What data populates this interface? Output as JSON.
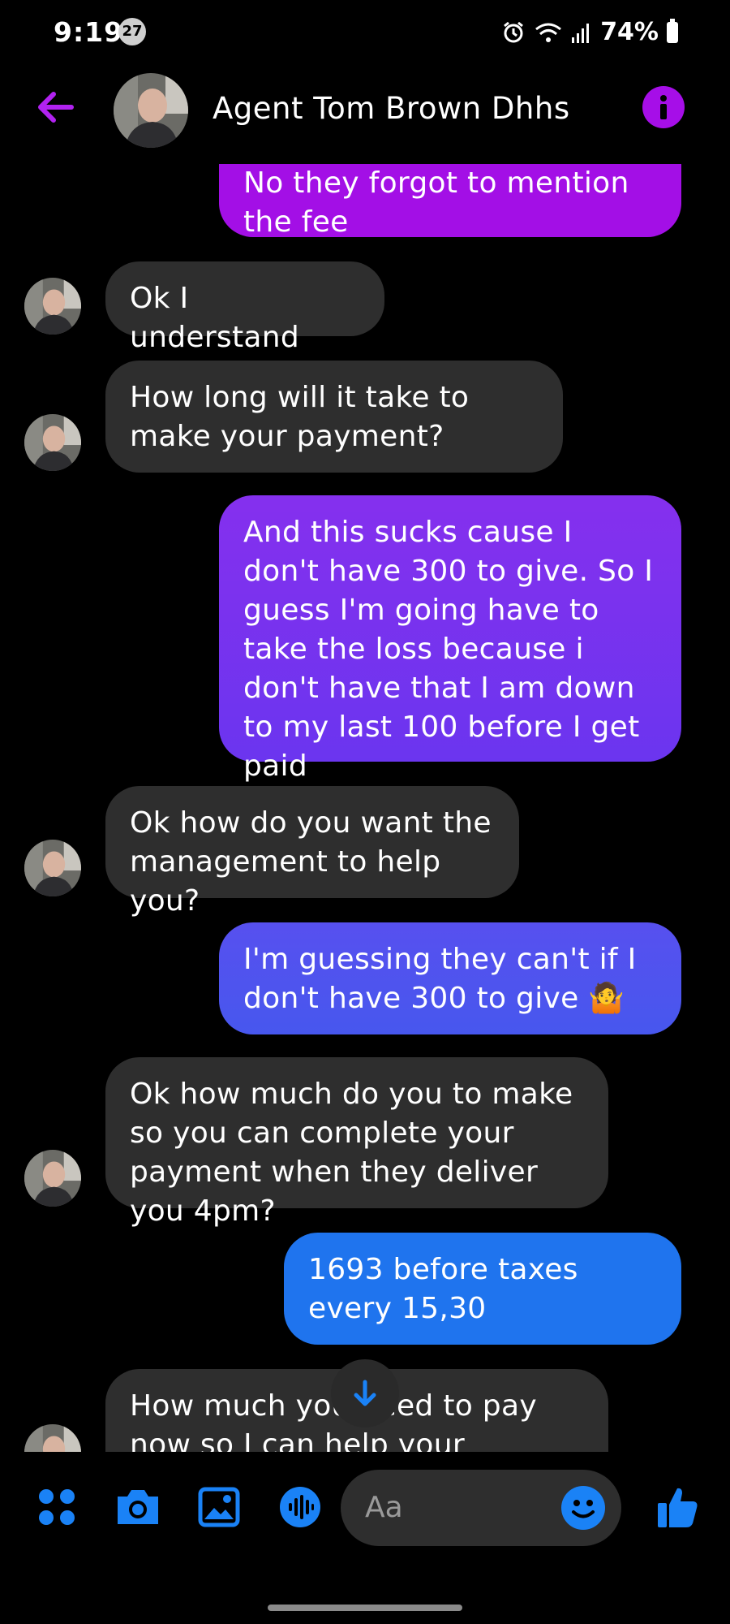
{
  "status_bar": {
    "time": "9:19",
    "notification_count": "27",
    "battery": "74%"
  },
  "header": {
    "contact_name": "Agent Tom Brown Dhhs"
  },
  "messages": [
    {
      "direction": "out",
      "text": "No they forgot to mention the fee",
      "color": "#a30fe6"
    },
    {
      "direction": "in",
      "text": "Ok I understand"
    },
    {
      "direction": "in",
      "text": "How long will it take to make your payment?"
    },
    {
      "direction": "out",
      "text": "And this sucks cause I don't have 300 to give. So I guess I'm going have to take the loss because i don't have that I am down to my last 100 before I get paid",
      "color": "#7b2ff0"
    },
    {
      "direction": "in",
      "text": "Ok how do you want the management to help you?"
    },
    {
      "direction": "out",
      "text": "I'm guessing they can't if I don't have 300 to give 🤷",
      "color": "#4d53ef"
    },
    {
      "direction": "in",
      "text": "Ok how much do you to make so you can complete your payment when they deliver you 4pm?"
    },
    {
      "direction": "out",
      "text": "1693 before taxes every 15,30",
      "color": "#1f74ee"
    },
    {
      "direction": "in",
      "text": "How much you need to pay now so I can help your delivery?"
    }
  ],
  "composer": {
    "placeholder": "Aa"
  },
  "colors": {
    "accent_purple": "#a60ee8",
    "accent_blue": "#1a82f6",
    "incoming_bubble": "#2e2e2e"
  }
}
